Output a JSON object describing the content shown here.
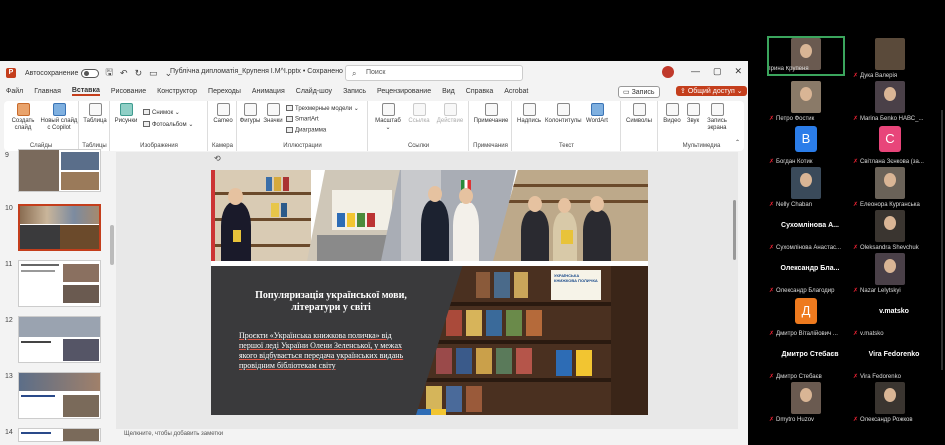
{
  "titlebar": {
    "autosave_label": "Автосохранение",
    "document_title": "Публічна дипломатія_Крупеня І.М^I.pptx • Сохранено",
    "search_placeholder": "Поиск"
  },
  "menu": {
    "items": [
      "Файл",
      "Главная",
      "Вставка",
      "Рисование",
      "Конструктор",
      "Переходы",
      "Анимация",
      "Слайд-шоу",
      "Запись",
      "Рецензирование",
      "Вид",
      "Справка",
      "Acrobat"
    ],
    "active_index": 2,
    "record_label": "Запись",
    "share_label": "Общий доступ"
  },
  "ribbon": {
    "groups": {
      "slides": "Слайды",
      "tables": "Таблицы",
      "images": "Изображения",
      "camera": "Камера",
      "illustrations": "Иллюстрации",
      "links": "Ссылки",
      "comments": "Примечания",
      "text": "Текст",
      "multimedia": "Мультимедиа"
    },
    "buttons": {
      "new_slide": "Создать слайд",
      "copilot_slide": "Новый слайд с Copilot",
      "table": "Таблица",
      "pictures": "Рисунки",
      "screenshot": "Снимок",
      "photo_album": "Фотоальбом",
      "cameo": "Cameo",
      "shapes": "Фигуры",
      "icons": "Значки",
      "models_3d": "Трехмерные модели",
      "smartart": "SmartArt",
      "chart": "Диаграмма",
      "zoom": "Масштаб",
      "link": "Ссылка",
      "action": "Действие",
      "comment": "Примечание",
      "textbox": "Надпись",
      "header_footer": "Колонтитулы",
      "wordart": "WordArt",
      "symbols": "Символы",
      "video": "Видео",
      "audio": "Звук",
      "screen_recording": "Запись экрана"
    }
  },
  "thumbnails": {
    "numbers": [
      "9",
      "10",
      "11",
      "12",
      "13",
      "14"
    ],
    "selected_index": 1
  },
  "slide": {
    "heading": "Популяризація української мови, літератури у світі",
    "body": "Проєкти «Українська книжкова поличка» від першої леді України Олени Зеленської, у межах якого відбувається передача українських видань провідним бібліотекам світу",
    "poster_text": "УКРАЇНСЬКА КНИЖКОВА ПОЛИЧКА"
  },
  "notes_placeholder": "Щелкните, чтобы добавить заметки",
  "participants": [
    {
      "name": "Ірина Крупеня",
      "type": "video",
      "speaking": true
    },
    {
      "name": "Дука Валерія",
      "type": "name"
    },
    {
      "name": "Петро Фостик",
      "type": "video"
    },
    {
      "name": "Marina Бenko НАВС_...",
      "type": "video"
    },
    {
      "name": "Богдан Котик",
      "type": "letter",
      "letter": "В",
      "color": "#2b7de9"
    },
    {
      "name": "Світлана Зєнкова (за...",
      "type": "letter",
      "letter": "С",
      "color": "#e8457a"
    },
    {
      "name": "Nelly Chaban",
      "type": "video"
    },
    {
      "name": "Елеонора Курганська",
      "type": "video"
    },
    {
      "name": "Сухомлінова Анастас...",
      "type": "name",
      "big": "Сухомлінова А..."
    },
    {
      "name": "Oleksandra Shevchuk",
      "type": "video"
    },
    {
      "name": "Олександр Благодир",
      "type": "name",
      "big": "Олександр Бла..."
    },
    {
      "name": "Nazar Lelytskyi",
      "type": "video"
    },
    {
      "name": "Дмитро Віталійович ...",
      "type": "letter",
      "letter": "Д",
      "color": "#ee7a1e"
    },
    {
      "name": "v.matsko",
      "type": "name",
      "big": "v.matsko"
    },
    {
      "name": "Дмитро Стебаєв",
      "type": "name",
      "big": "Дмитро Стебаєв"
    },
    {
      "name": "Vira Fedorenko",
      "type": "name",
      "big": "Vira Fedorenko"
    },
    {
      "name": "Dmytro Huzov",
      "type": "video"
    },
    {
      "name": "Олександр Рожков",
      "type": "video"
    }
  ],
  "colors": {
    "accent": "#c43e1c",
    "slide_panel": "#3a3a3c",
    "speaking": "#3ba55d"
  }
}
